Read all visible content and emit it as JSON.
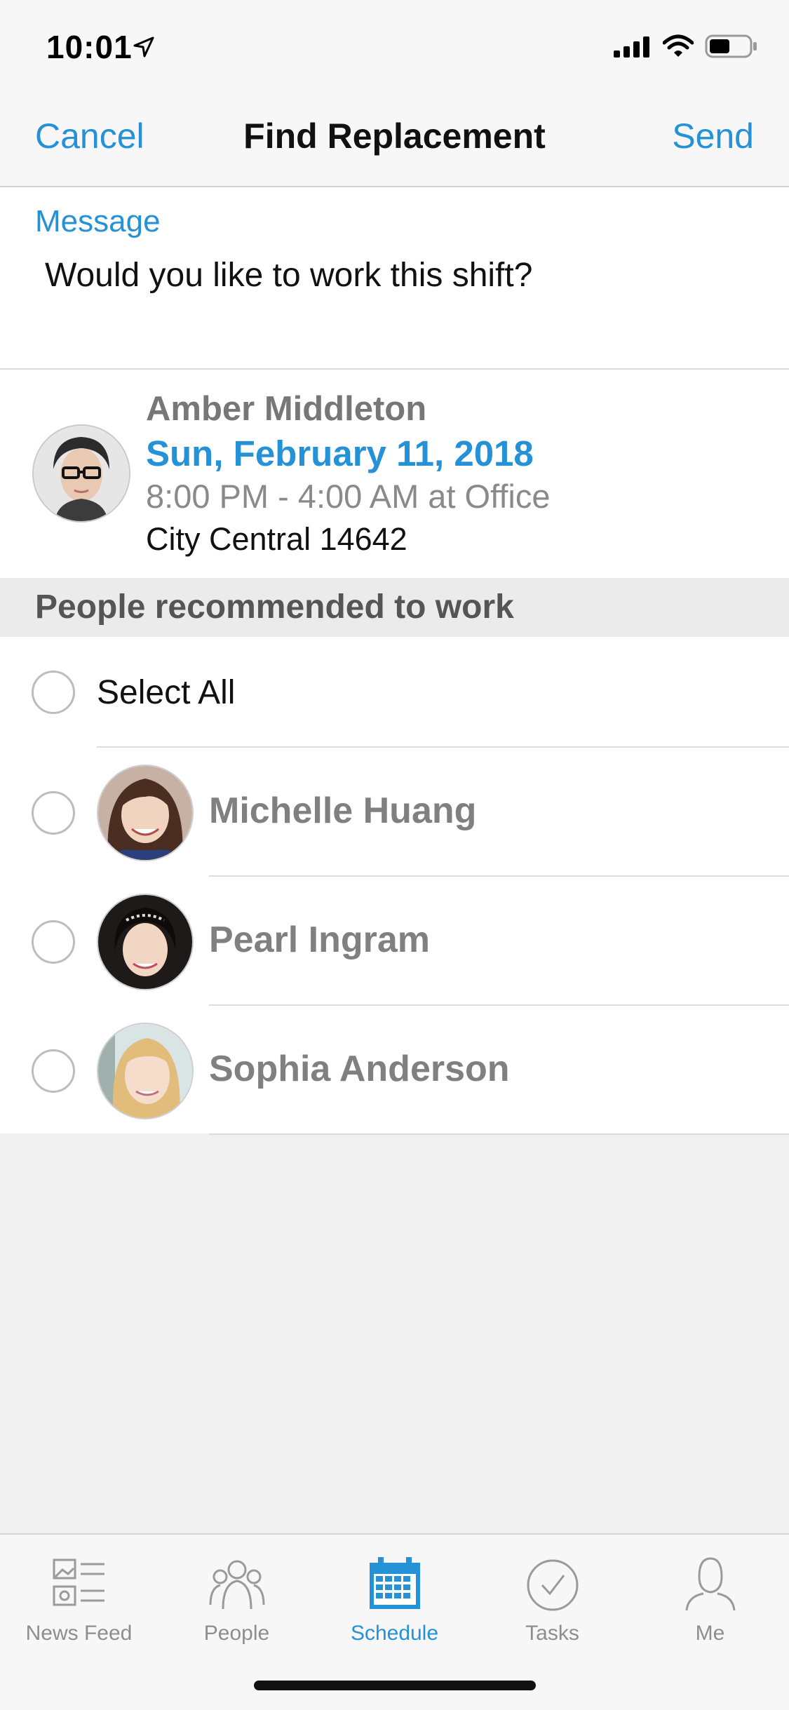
{
  "status_bar": {
    "time": "10:01"
  },
  "nav": {
    "cancel": "Cancel",
    "title": "Find Replacement",
    "send": "Send"
  },
  "message": {
    "label": "Message",
    "text": "Would you like to work this shift?"
  },
  "shift": {
    "name": "Amber Middleton",
    "date": "Sun, February 11, 2018",
    "time": "8:00 PM - 4:00 AM at Office",
    "location": "City Central 14642"
  },
  "recommended": {
    "header": "People recommended to work",
    "select_all": "Select All",
    "people": [
      {
        "name": "Michelle Huang"
      },
      {
        "name": "Pearl Ingram"
      },
      {
        "name": "Sophia Anderson"
      }
    ]
  },
  "tabs": [
    {
      "label": "News Feed",
      "icon": "news-feed-icon"
    },
    {
      "label": "People",
      "icon": "people-icon"
    },
    {
      "label": "Schedule",
      "icon": "calendar-icon",
      "active": true
    },
    {
      "label": "Tasks",
      "icon": "check-circle-icon"
    },
    {
      "label": "Me",
      "icon": "person-icon"
    }
  ],
  "colors": {
    "accent": "#2591d6",
    "background": "#f1f1f1",
    "header_band": "#ebebeb"
  }
}
